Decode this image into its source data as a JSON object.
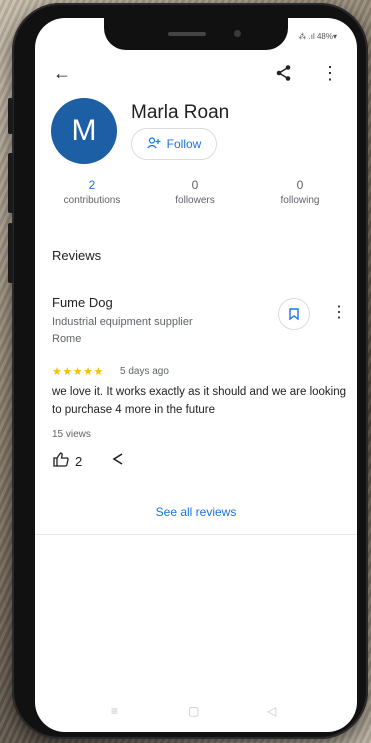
{
  "status": {
    "text": "⁂ .ıl 48%▾"
  },
  "profile": {
    "initial": "M",
    "name": "Marla Roan",
    "follow_label": "Follow"
  },
  "stats": [
    {
      "value": "2",
      "label": "contributions"
    },
    {
      "value": "0",
      "label": "followers"
    },
    {
      "value": "0",
      "label": "following"
    }
  ],
  "reviews_title": "Reviews",
  "review": {
    "place_name": "Fume Dog",
    "place_type": "Industrial equipment supplier",
    "place_location": "Rome",
    "stars": "★★★★★",
    "time_ago": "5 days ago",
    "text": "we love it.  It works exactly as it should and we are looking to purchase 4 more in the future",
    "views": "15 views",
    "likes": "2"
  },
  "see_all_label": "See all reviews",
  "colors": {
    "accent": "#1a73e8",
    "avatar": "#1d5fa4",
    "star": "#fbbc04"
  }
}
